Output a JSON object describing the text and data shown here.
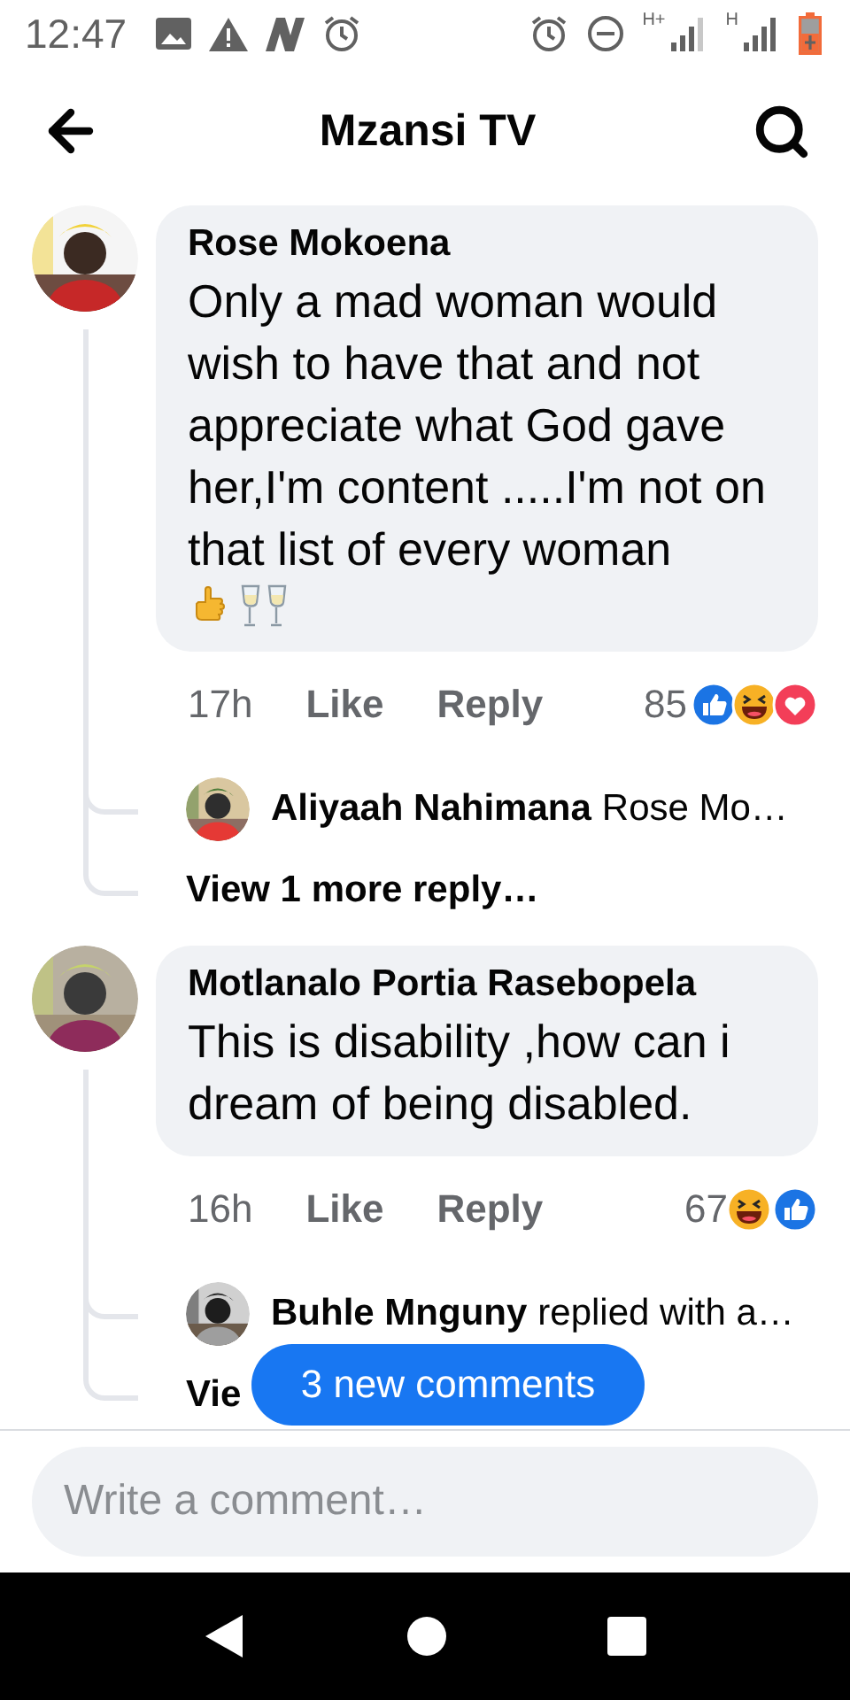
{
  "status_bar": {
    "time": "12:47",
    "network_labels": [
      "H+",
      "H"
    ]
  },
  "header": {
    "title": "Mzansi TV"
  },
  "comments": [
    {
      "author": "Rose Mokoena",
      "text": "Only a mad woman would wish to have that and not appreciate what God gave her,I'm content .....I'm not on that list of every woman",
      "emoji": [
        {
          "kind": "hand"
        },
        {
          "kind": "glasses"
        }
      ],
      "time": "17h",
      "like": "Like",
      "reply": "Reply",
      "reaction_count": "85",
      "reactions": [
        {
          "kind": "like"
        },
        {
          "kind": "haha"
        },
        {
          "kind": "love"
        }
      ],
      "reply_preview": {
        "author": "Aliyaah Nahimana",
        "text": "Rose Mo…"
      },
      "view_more": "View 1 more reply…"
    },
    {
      "author": "Motlanalo Portia Rasebopela",
      "text": "This is disability ,how can i dream of being disabled.",
      "time": "16h",
      "like": "Like",
      "reply": "Reply",
      "reaction_count": "67",
      "reactions": [
        {
          "kind": "haha"
        },
        {
          "kind": "like"
        }
      ],
      "reply_preview": {
        "author": "Buhle Mnguny",
        "text": "replied with a…"
      },
      "view_more": "Vie"
    }
  ],
  "new_comments_button": "3 new comments",
  "composer": {
    "placeholder": "Write a comment…"
  }
}
